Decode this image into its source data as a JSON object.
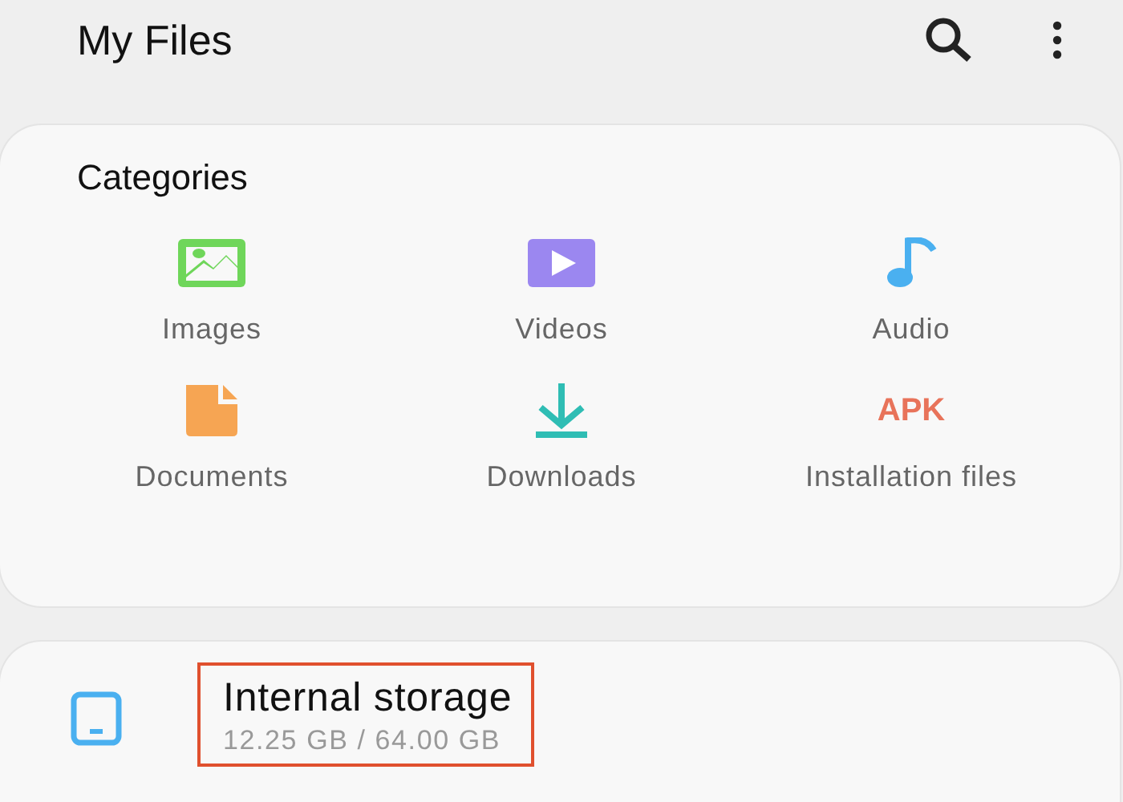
{
  "app_bar": {
    "title": "My Files"
  },
  "categories": {
    "title": "Categories",
    "items": [
      {
        "label": "Images",
        "kind": "image"
      },
      {
        "label": "Videos",
        "kind": "video"
      },
      {
        "label": "Audio",
        "kind": "audio"
      },
      {
        "label": "Documents",
        "kind": "document"
      },
      {
        "label": "Downloads",
        "kind": "download"
      },
      {
        "label": "Installation files",
        "kind": "text",
        "icon_text": "APK"
      }
    ]
  },
  "storage": [
    {
      "name": "Internal storage",
      "usage": "12.25 GB / 64.00 GB",
      "highlighted": true
    }
  ]
}
